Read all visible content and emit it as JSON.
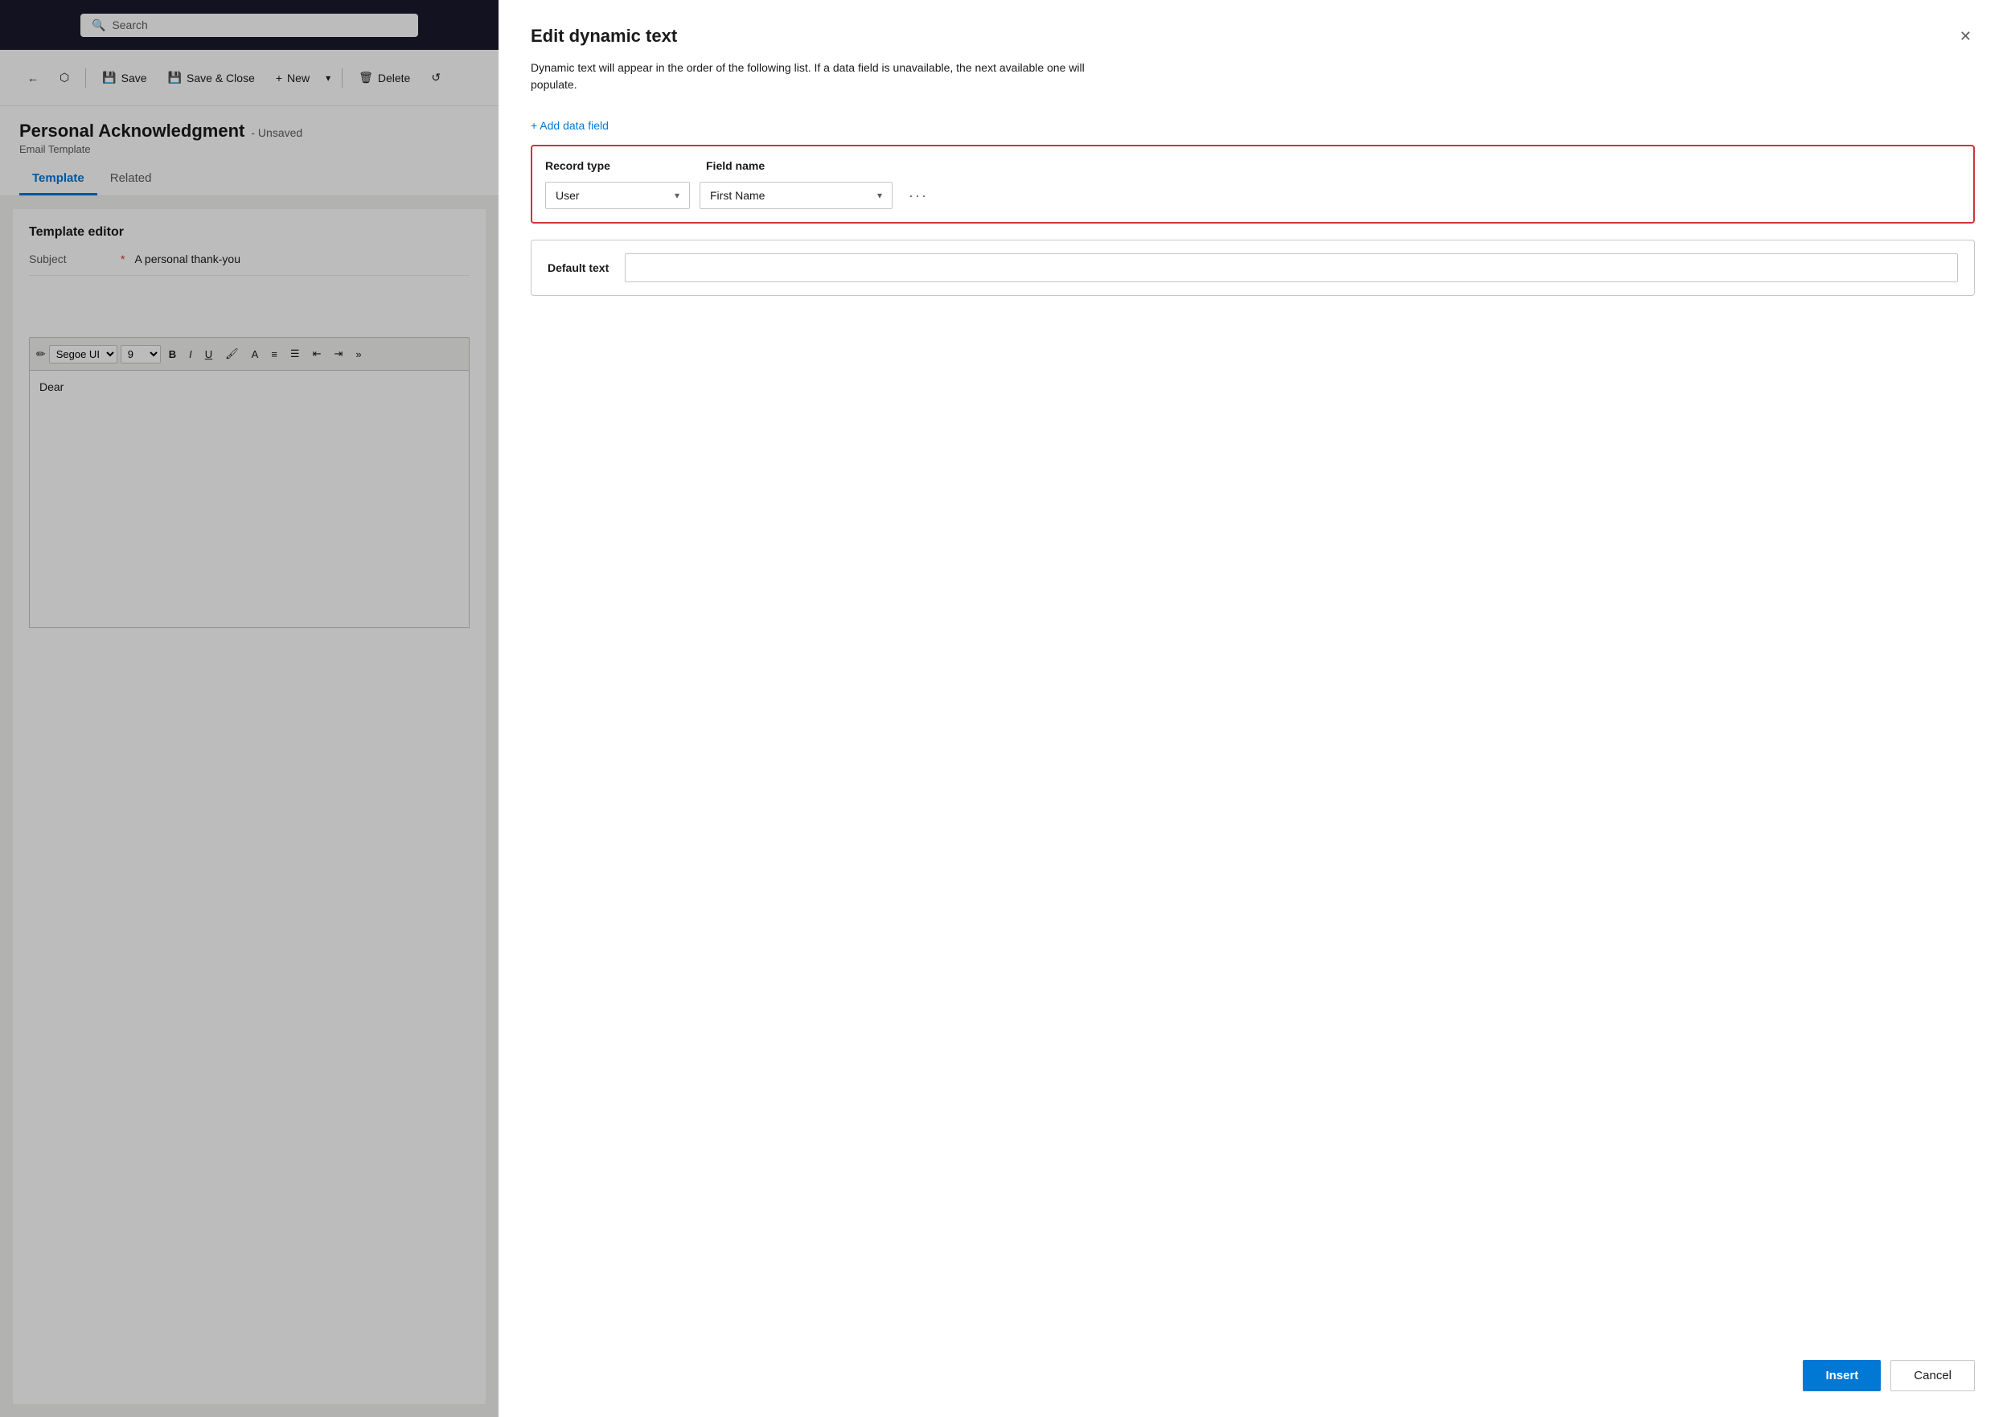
{
  "topbar": {
    "search_placeholder": "Search"
  },
  "toolbar": {
    "back_label": "←",
    "share_label": "⬡",
    "save_label": "Save",
    "save_close_label": "Save & Close",
    "new_label": "New",
    "delete_label": "Delete",
    "refresh_label": "↺"
  },
  "page": {
    "title": "Personal Acknowledgment",
    "unsaved": "- Unsaved",
    "subtitle": "Email Template"
  },
  "tabs": [
    {
      "label": "Template",
      "active": true
    },
    {
      "label": "Related",
      "active": false
    }
  ],
  "editor": {
    "title": "Template editor",
    "subject_label": "Subject",
    "subject_required": "*",
    "subject_value": "A personal thank-you",
    "font_family": "Segoe UI",
    "font_size": "9",
    "body_text": "Dear"
  },
  "dialog": {
    "title": "Edit dynamic text",
    "description": "Dynamic text will appear in the order of the following list. If a data field is unavailable, the next available one will populate.",
    "close_label": "✕",
    "add_field_label": "+ Add data field",
    "col_record_type": "Record type",
    "col_field_name": "Field name",
    "record_type_value": "User",
    "field_name_value": "First Name",
    "more_btn_label": "···",
    "default_text_label": "Default text",
    "default_text_placeholder": "",
    "insert_label": "Insert",
    "cancel_label": "Cancel"
  }
}
